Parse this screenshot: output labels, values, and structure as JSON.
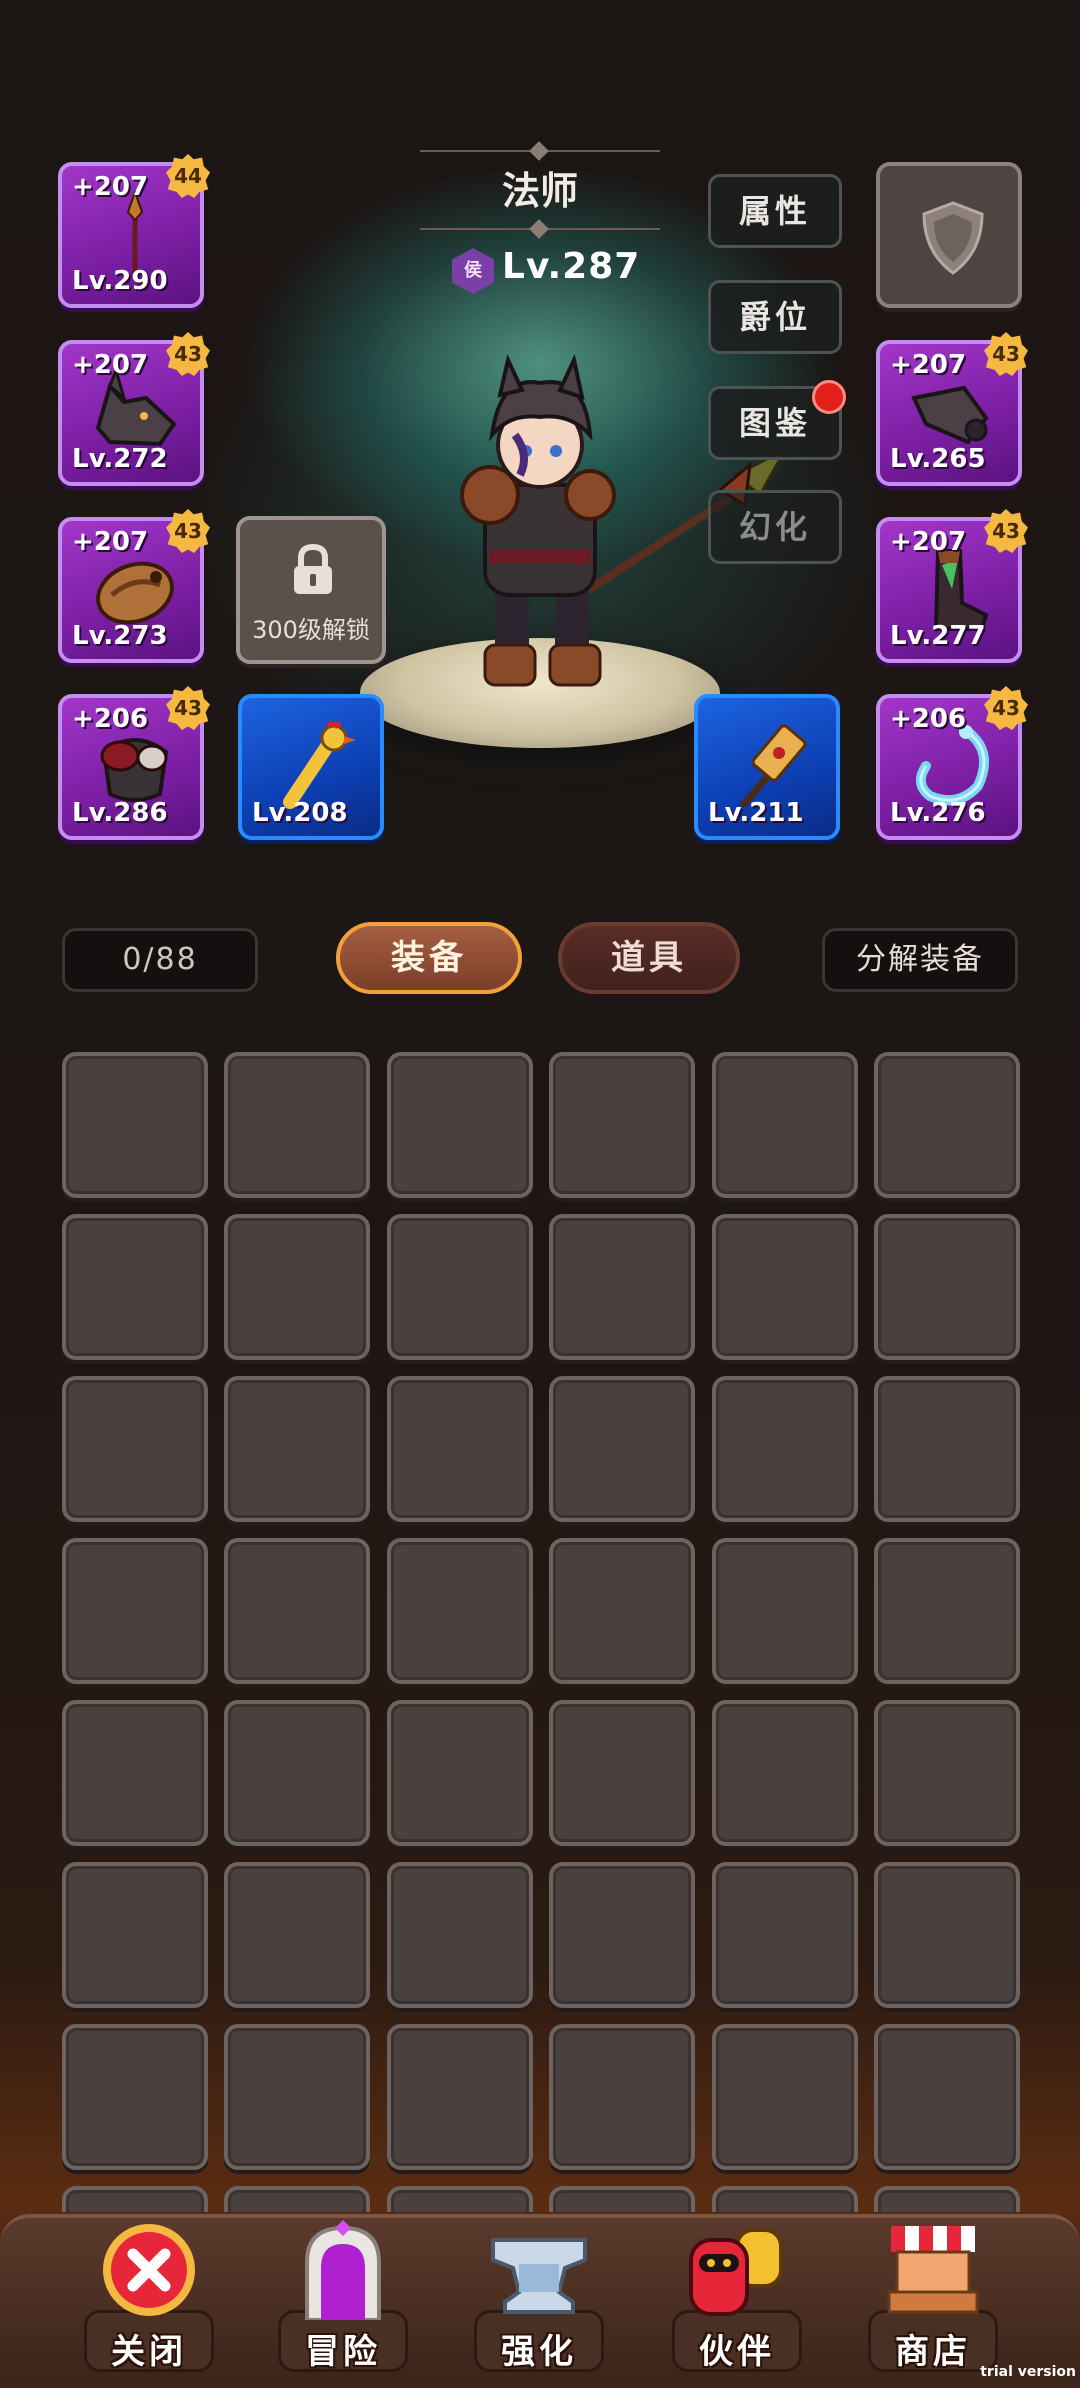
{
  "hero": {
    "class_name": "法师",
    "rank_badge": "侯",
    "level": "Lv.287"
  },
  "equipment_left": [
    {
      "plus": "+207",
      "stars": "44",
      "level": "Lv.290",
      "icon": "staff-icon"
    },
    {
      "plus": "+207",
      "stars": "43",
      "level": "Lv.272",
      "icon": "wolf-helmet-icon"
    },
    {
      "plus": "+207",
      "stars": "43",
      "level": "Lv.273",
      "icon": "shoulder-armor-icon"
    },
    {
      "plus": "+206",
      "stars": "43",
      "level": "Lv.286",
      "icon": "chest-armor-icon"
    }
  ],
  "equipment_right": [
    {
      "plus": "+207",
      "stars": "43",
      "level": "Lv.265",
      "icon": "gauntlet-icon"
    },
    {
      "plus": "+207",
      "stars": "43",
      "level": "Lv.277",
      "icon": "boots-icon"
    },
    {
      "plus": "+206",
      "stars": "43",
      "level": "Lv.276",
      "icon": "ring-icon"
    }
  ],
  "special_slots": {
    "locked_text": "300级解锁",
    "chicken_level": "Lv.208",
    "hammer_level": "Lv.211"
  },
  "side_buttons": {
    "attributes": "属性",
    "title": "爵位",
    "codex": "图鉴",
    "transform": "幻化"
  },
  "tabs": {
    "inventory_count": "0/88",
    "equipment": "装备",
    "items": "道具",
    "decompose": "分解装备"
  },
  "nav": {
    "close": "关闭",
    "adventure": "冒险",
    "enhance": "强化",
    "partner": "伙伴",
    "shop": "商店"
  },
  "watermark": "trial version",
  "colors": {
    "epic_purple": "#8a2bb5",
    "rare_blue": "#1450d0",
    "star_gold": "#f5b840",
    "active_tab_border": "#f2a03a",
    "notification_red": "#e4201c"
  }
}
